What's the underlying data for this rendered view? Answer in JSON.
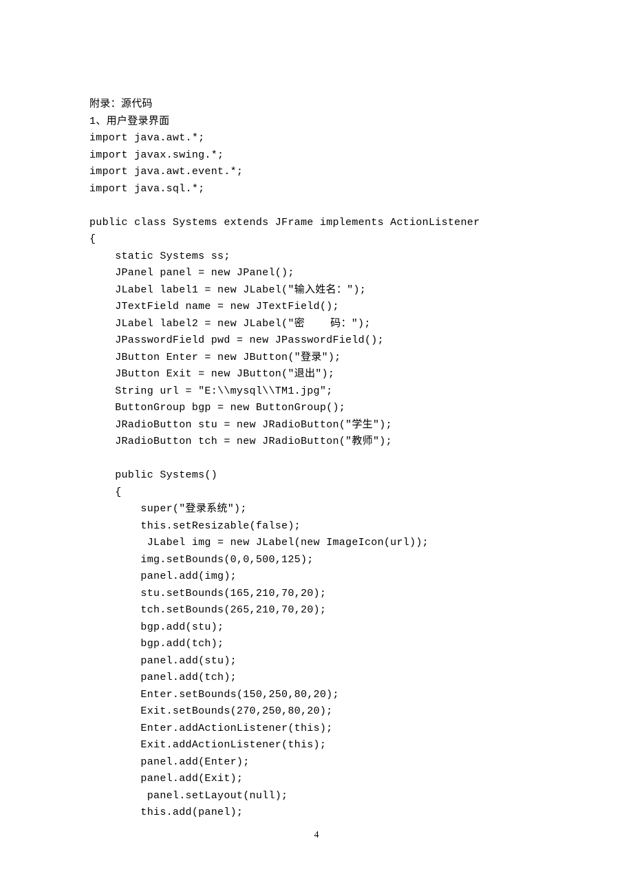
{
  "document": {
    "lines": [
      "附录：源代码",
      "1、用户登录界面",
      "import java.awt.*;",
      "import javax.swing.*;",
      "import java.awt.event.*;",
      "import java.sql.*;",
      "",
      "public class Systems extends JFrame implements ActionListener",
      "{",
      "    static Systems ss;",
      "    JPanel panel = new JPanel();",
      "    JLabel label1 = new JLabel(\"输入姓名：\");",
      "    JTextField name = new JTextField();",
      "    JLabel label2 = new JLabel(\"密    码：\");",
      "    JPasswordField pwd = new JPasswordField();",
      "    JButton Enter = new JButton(\"登录\");",
      "    JButton Exit = new JButton(\"退出\");",
      "    String url = \"E:\\\\mysql\\\\TM1.jpg\";",
      "    ButtonGroup bgp = new ButtonGroup();",
      "    JRadioButton stu = new JRadioButton(\"学生\");",
      "    JRadioButton tch = new JRadioButton(\"教师\");",
      "",
      "    public Systems()",
      "    {",
      "        super(\"登录系统\");",
      "        this.setResizable(false);",
      "         JLabel img = new JLabel(new ImageIcon(url));",
      "        img.setBounds(0,0,500,125);",
      "        panel.add(img);",
      "        stu.setBounds(165,210,70,20);",
      "        tch.setBounds(265,210,70,20);",
      "        bgp.add(stu);",
      "        bgp.add(tch);",
      "        panel.add(stu);",
      "        panel.add(tch);",
      "        Enter.setBounds(150,250,80,20);",
      "        Exit.setBounds(270,250,80,20);",
      "        Enter.addActionListener(this);",
      "        Exit.addActionListener(this);",
      "        panel.add(Enter);",
      "        panel.add(Exit);",
      "         panel.setLayout(null);",
      "        this.add(panel);"
    ],
    "page_number": "4"
  }
}
